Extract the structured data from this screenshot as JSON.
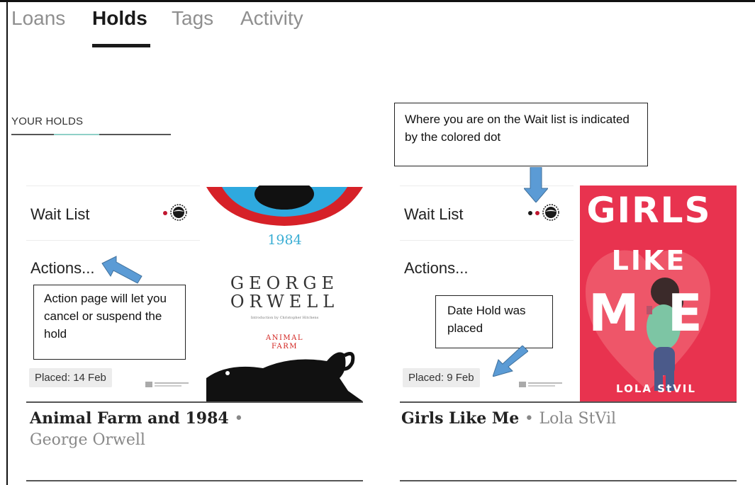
{
  "tabs": [
    "Loans",
    "Holds",
    "Tags",
    "Activity"
  ],
  "section_label": "YOUR HOLDS",
  "holds": [
    {
      "wait_list_label": "Wait List",
      "actions_label": "Actions...",
      "placed": "Placed: 14 Feb",
      "title": "Animal Farm and 1984",
      "author": "George Orwell",
      "cover": {
        "number": "1984",
        "author_line1": "GEORGE",
        "author_line2": "ORWELL",
        "intro": "Introduction by Christopher Hitchens",
        "title_line1": "ANIMAL",
        "title_line2": "FARM"
      },
      "callout": "Action page will let you cancel or suspend the hold"
    },
    {
      "wait_list_label": "Wait List",
      "actions_label": "Actions...",
      "placed": "Placed: 9 Feb",
      "title": "Girls Like Me",
      "author": "Lola StVil",
      "cover": {
        "line1": "GIRLS",
        "line2": "LIKE",
        "line3": "ME",
        "author": "LOLA StVIL"
      },
      "callout": "Date Hold was placed"
    }
  ],
  "waitlist_callout": "Where you are on the Wait list is indicated by the colored dot",
  "separator": "•",
  "colors": {
    "dot_red": "#c0162f",
    "dot_dark": "#1a1a1a",
    "arrow_blue": "#5b9bd5",
    "girls_cover_red": "#e8334f"
  }
}
